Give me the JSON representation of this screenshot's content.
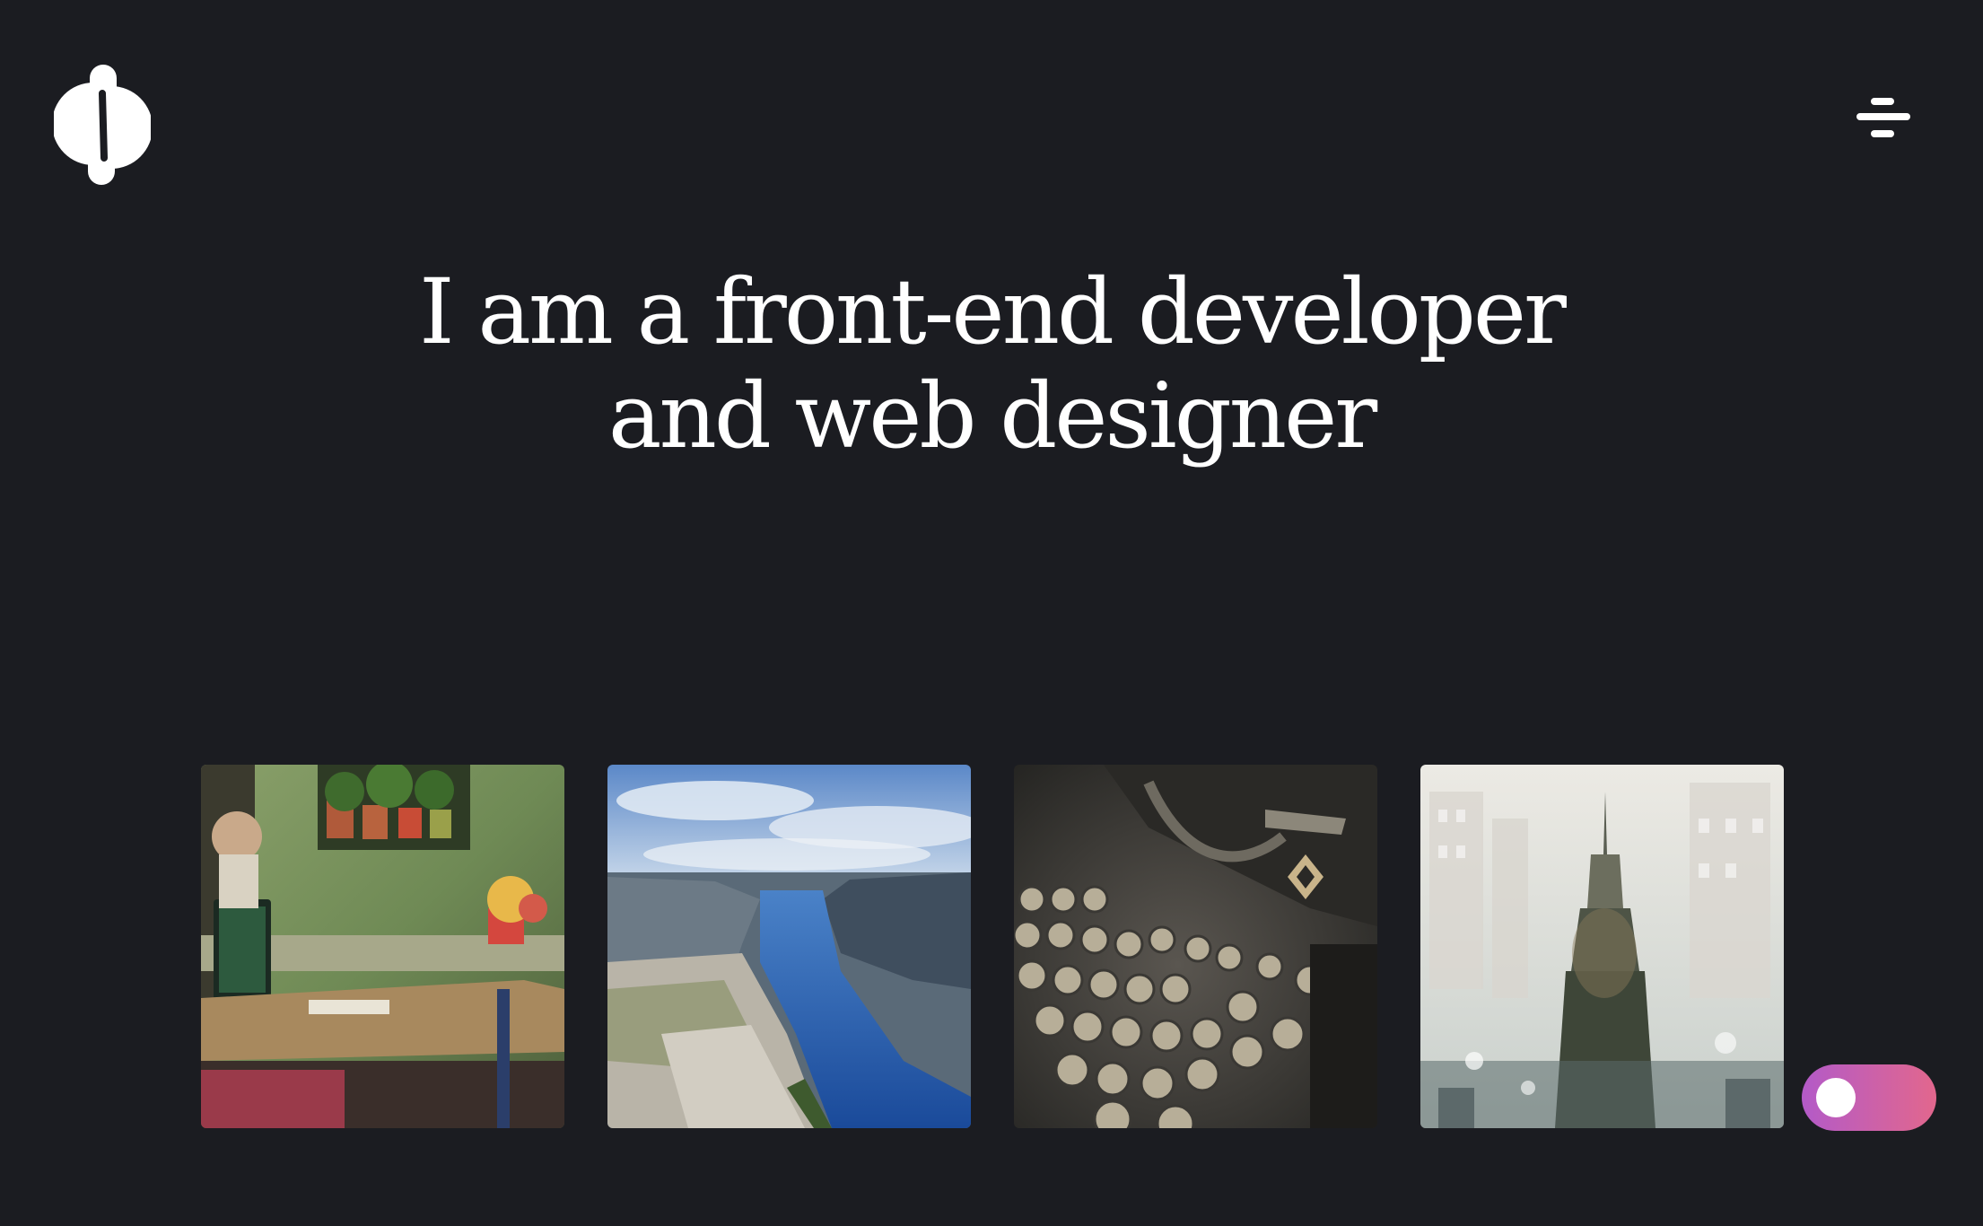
{
  "header": {
    "logo_icon": "brand-logo-icon",
    "menu_icon": "hamburger-menu-icon"
  },
  "hero": {
    "line1": "I am a front-end developer",
    "line2": "and web designer"
  },
  "gallery": {
    "items": [
      {
        "icon": "cafe-terrace-photo"
      },
      {
        "icon": "fjord-landscape-photo"
      },
      {
        "icon": "vintage-typewriter-photo"
      },
      {
        "icon": "city-skyscraper-photo"
      }
    ]
  },
  "theme_toggle": {
    "state": "off",
    "gradient_start": "#b35ac8",
    "gradient_end": "#e2678d"
  },
  "colors": {
    "background": "#1b1c21",
    "text": "#ffffff"
  }
}
